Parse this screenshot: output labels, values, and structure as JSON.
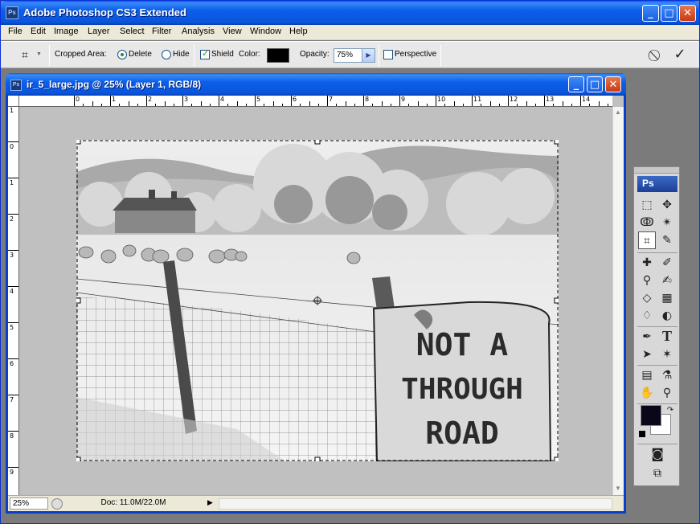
{
  "app": {
    "title": "Adobe Photoshop CS3 Extended",
    "icon": "ps-app-icon"
  },
  "window_buttons": {
    "minimize": "_",
    "maximize": "□",
    "close": "✕"
  },
  "menu": [
    "File",
    "Edit",
    "Image",
    "Layer",
    "Select",
    "Filter",
    "Analysis",
    "View",
    "Window",
    "Help"
  ],
  "options": {
    "tool_icon": "crop-icon",
    "cropped_area_label": "Cropped Area:",
    "delete_label": "Delete",
    "hide_label": "Hide",
    "cropped_area_selected": "Delete",
    "shield_label": "Shield",
    "shield_checked": true,
    "color_label": "Color:",
    "shield_color": "#000000",
    "opacity_label": "Opacity:",
    "opacity_value": "75%",
    "perspective_label": "Perspective",
    "perspective_checked": false,
    "cancel_icon": "cancel-icon",
    "commit_icon": "commit-check-icon"
  },
  "document": {
    "title": "ir_5_large.jpg @ 25% (Layer 1, RGB/8)",
    "ruler_h": [
      "0",
      "1",
      "2",
      "3",
      "4",
      "5",
      "6",
      "7",
      "8",
      "9",
      "10",
      "11",
      "12",
      "13",
      "14"
    ],
    "ruler_v": [
      "1",
      "0",
      "1",
      "2",
      "3",
      "4",
      "5",
      "6",
      "7",
      "8",
      "9"
    ],
    "zoom": "25%",
    "doc_info": "Doc: 11.0M/22.0M",
    "sign_text": [
      "NOT A",
      "THROUGH",
      "ROAD"
    ]
  },
  "toolbox": {
    "logo": "Ps",
    "foreground_color": "#08081a",
    "background_color": "#ffffff"
  }
}
